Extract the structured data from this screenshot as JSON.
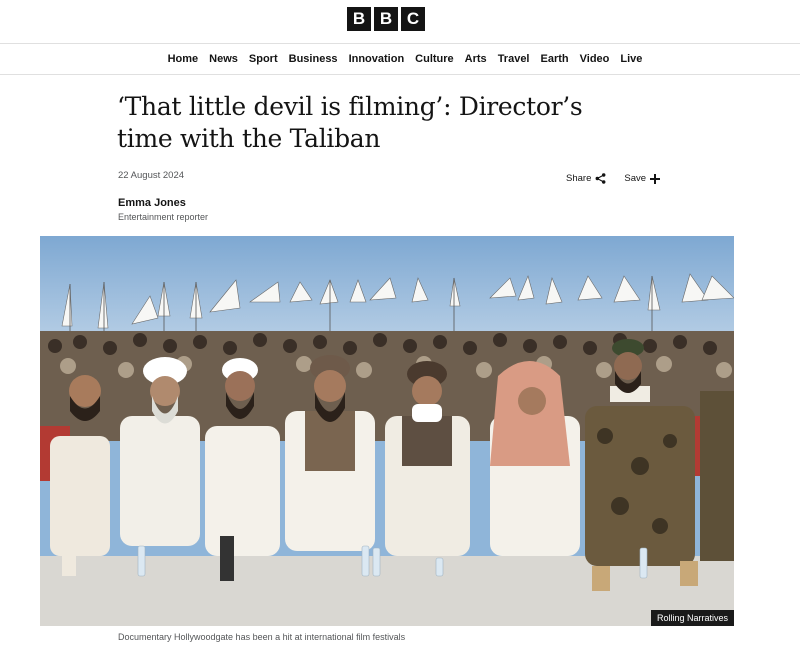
{
  "logo": [
    "B",
    "B",
    "C"
  ],
  "nav": {
    "items": [
      "Home",
      "News",
      "Sport",
      "Business",
      "Innovation",
      "Culture",
      "Arts",
      "Travel",
      "Earth",
      "Video",
      "Live"
    ]
  },
  "article": {
    "headline_line1": "‘That little devil is filming’: Director’s",
    "headline_line2": "time with the Taliban",
    "date": "22 August 2024",
    "share_label": "Share",
    "save_label": "Save",
    "author_name": "Emma Jones",
    "author_role": "Entertainment reporter",
    "image_credit": "Rolling Narratives",
    "image_caption": "Documentary Hollywoodgate has been a hit at international film festivals"
  },
  "colors": {
    "brand": "#141414",
    "sky": "#8fb5d9",
    "ground": "#d9d7d2",
    "muted_text": "#545658"
  },
  "icons": {
    "share": "share-icon",
    "save": "plus-icon"
  }
}
